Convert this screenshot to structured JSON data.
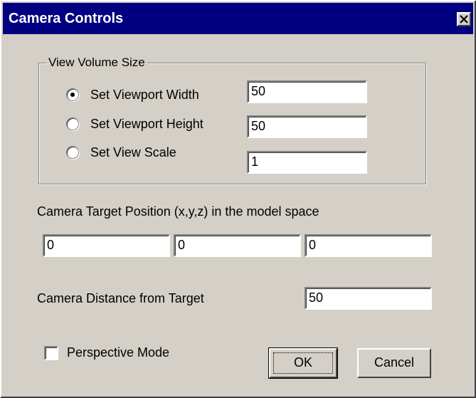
{
  "window": {
    "title": "Camera Controls",
    "close_icon": "close-icon"
  },
  "view_volume": {
    "legend": "View Volume Size",
    "options": [
      {
        "label": "Set Viewport Width",
        "value": "50",
        "selected": true
      },
      {
        "label": "Set Viewport Height",
        "value": "50",
        "selected": false
      },
      {
        "label": "Set View Scale",
        "value": "1",
        "selected": false
      }
    ]
  },
  "target": {
    "label": "Camera Target Position (x,y,z) in the model space",
    "x": "0",
    "y": "0",
    "z": "0"
  },
  "distance": {
    "label": "Camera Distance from Target",
    "value": "50"
  },
  "perspective": {
    "label": "Perspective Mode",
    "checked": false
  },
  "buttons": {
    "ok": "OK",
    "cancel": "Cancel"
  },
  "colors": {
    "titlebar": "#000080",
    "face": "#d4d0c8"
  }
}
